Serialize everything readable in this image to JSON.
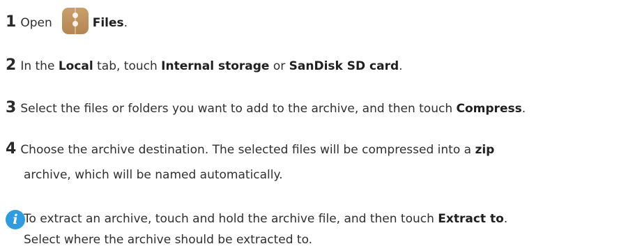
{
  "steps": [
    {
      "number": "1",
      "open": "Open",
      "app_name": "Files",
      "end": "."
    },
    {
      "number": "2",
      "t1": "In the",
      "local": "Local",
      "t2": "tab, touch",
      "internal": "Internal storage",
      "t3": "or",
      "sd": "SanDisk SD card",
      "end": "."
    },
    {
      "number": "3",
      "t1": "Select the files or folders you want to add to the archive, and then touch",
      "compress": "Compress",
      "end": "."
    },
    {
      "number": "4",
      "t1": "Choose the archive destination. The selected files will be compressed into a",
      "zip": "zip",
      "t2": "archive, which will be named automatically."
    }
  ],
  "note": {
    "icon": "info-icon",
    "t1": "To extract an archive, touch and hold the archive file, and then touch",
    "extract": "Extract to",
    "end": ".",
    "t2": "Select where the archive should be extracted to."
  },
  "colors": {
    "info_icon": "#2f9be0",
    "app_icon": "#c09264"
  }
}
